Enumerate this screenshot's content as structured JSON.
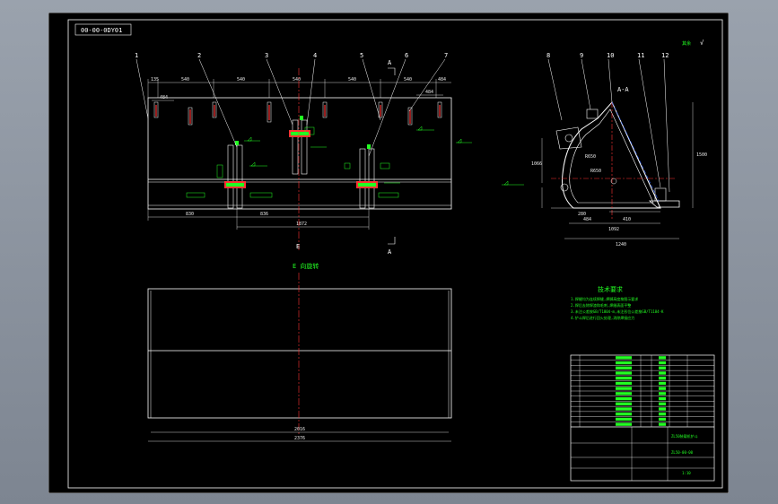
{
  "drawing_code": "00-00-0DY01",
  "balloons": [
    "1",
    "2",
    "3",
    "4",
    "5",
    "6",
    "7",
    "8",
    "9",
    "10",
    "11",
    "12"
  ],
  "section_marks": {
    "a_top": "A",
    "a_bottom": "A",
    "aa": "A-A",
    "e_top": "E",
    "e_bottom": "E"
  },
  "front_view": {
    "top_dims": [
      "135",
      "540",
      "540",
      "540",
      "540",
      "540",
      "484"
    ],
    "small_dims": [
      "484",
      "484"
    ],
    "bottom_dims": [
      "830",
      "836",
      "1872"
    ]
  },
  "bottom_view": {
    "title": "E 向旋转",
    "dims": [
      "2016",
      "2376"
    ]
  },
  "side_view": {
    "dims": [
      "1066",
      "410",
      "1092",
      "1240",
      "1500",
      "484",
      "280"
    ],
    "radius_labels": [
      "R650",
      "R650"
    ],
    "corner_symbol": "其余",
    "roughness": "√"
  },
  "tech_req": {
    "title": "技术要求",
    "lines": [
      "1.焊缝均为连续焊缝,焊脚高度按图示要求",
      "2.焊后去除焊渣和毛刺,焊缝表面平整",
      "3.未注公差按GB/T1804-m,未注形位公差按GB/T1184-K",
      "4.铲斗焊后进行回火处理,消除焊接应力"
    ]
  },
  "title_block": {
    "rows": 14,
    "drawing_title": "ZL50装载机铲斗",
    "drawing_no": "ZL50-00-00",
    "scale": "1:10"
  }
}
